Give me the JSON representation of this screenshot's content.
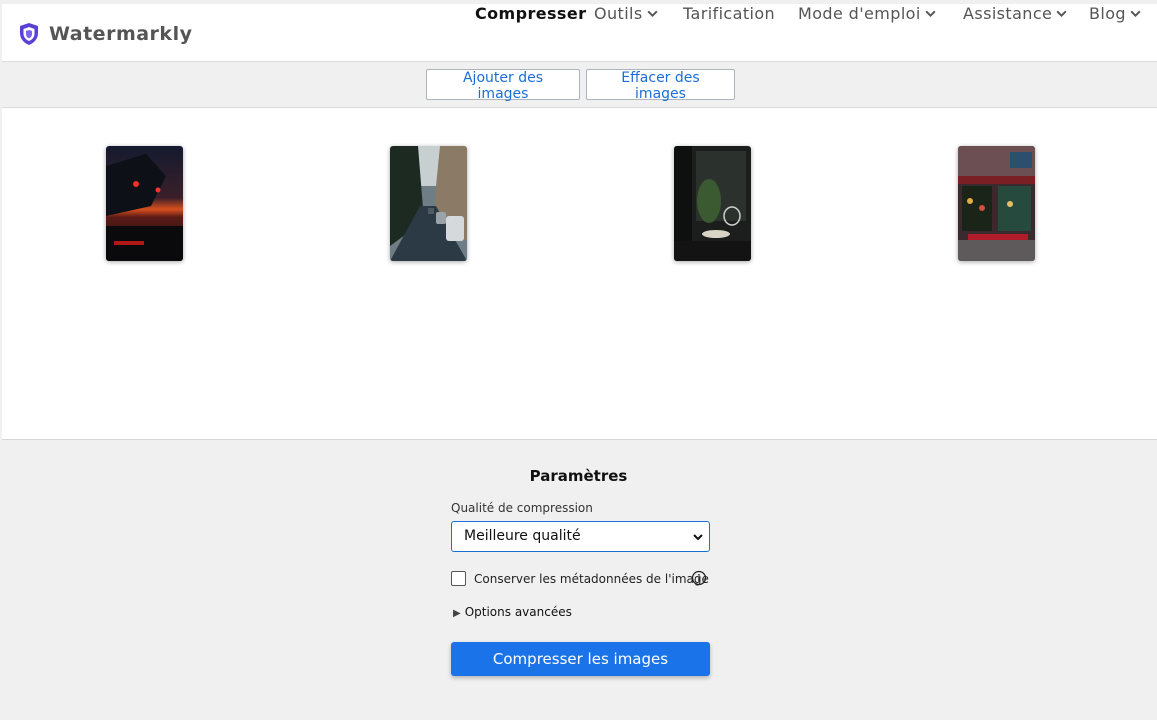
{
  "header": {
    "brand": "Watermarkly",
    "nav": [
      {
        "label": "Compresser",
        "active": true,
        "dropdown": false
      },
      {
        "label": "Outils",
        "active": false,
        "dropdown": true
      },
      {
        "label": "Tarification",
        "active": false,
        "dropdown": false
      },
      {
        "label": "Mode d'emploi",
        "active": false,
        "dropdown": true
      },
      {
        "label": "Assistance",
        "active": false,
        "dropdown": true
      },
      {
        "label": "Blog",
        "active": false,
        "dropdown": true
      }
    ]
  },
  "toolbar": {
    "add_label": "Ajouter des images",
    "clear_label": "Effacer des images"
  },
  "images": [
    {
      "description_icon": "photo-sunset-balcony-thumbnail"
    },
    {
      "description_icon": "photo-city-street-thumbnail"
    },
    {
      "description_icon": "photo-dark-cafe-interior-thumbnail"
    },
    {
      "description_icon": "photo-storefront-night-thumbnail"
    }
  ],
  "settings": {
    "title": "Paramètres",
    "quality_label": "Qualité de compression",
    "quality_value": "Meilleure qualité",
    "keep_metadata_label": "Conserver les métadonnées de l'image",
    "keep_metadata_checked": false,
    "advanced_label": "Options avancées",
    "compress_label": "Compresser les images"
  },
  "colors": {
    "accent": "#1a73e8",
    "link": "#1a6ed8",
    "logo": "#5b3fd6"
  }
}
